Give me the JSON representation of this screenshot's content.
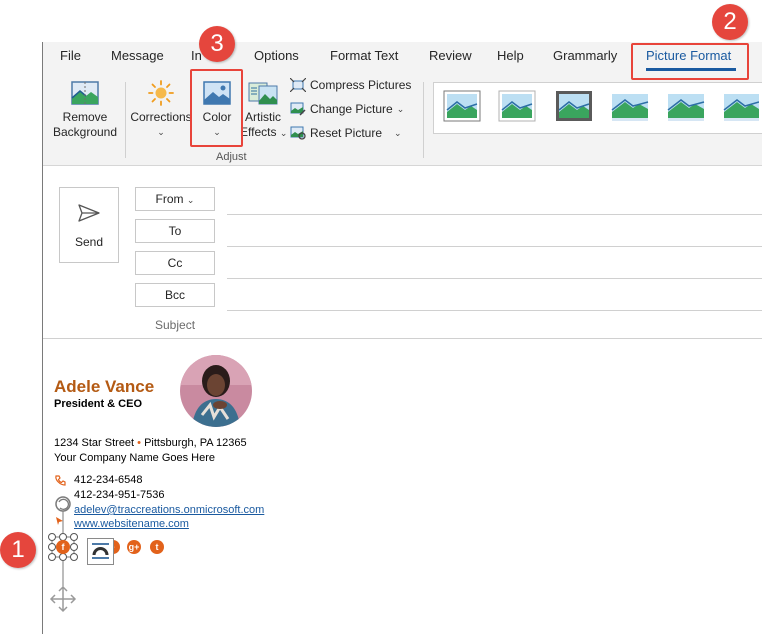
{
  "ribbon": {
    "tabs": [
      {
        "label": "File"
      },
      {
        "label": "Message"
      },
      {
        "label": "In"
      },
      {
        "label": "Options"
      },
      {
        "label": "Format Text"
      },
      {
        "label": "Review"
      },
      {
        "label": "Help"
      },
      {
        "label": "Grammarly"
      },
      {
        "label": "Picture Format"
      }
    ],
    "remove_background": {
      "line1": "Remove",
      "line2": "Background"
    },
    "corrections": {
      "label": "Corrections"
    },
    "color": {
      "label": "Color"
    },
    "artistic_effects": {
      "line1": "Artistic",
      "line2": "Effects"
    },
    "compress": "Compress Pictures",
    "change_picture": "Change Picture",
    "reset_picture": "Reset Picture",
    "adjust_group": "Adjust"
  },
  "callouts": {
    "one": "1",
    "two": "2",
    "three": "3"
  },
  "compose": {
    "send": "Send",
    "from": "From",
    "to": "To",
    "cc": "Cc",
    "bcc": "Bcc",
    "subject": "Subject"
  },
  "signature": {
    "name": "Adele Vance",
    "title": "President & CEO",
    "address_street": "1234 Star Street",
    "address_city": "Pittsburgh, PA 12365",
    "address_sep": "•",
    "company": "Your Company Name Goes Here",
    "phone1": "412-234-6548",
    "phone2": "412-234-951-7536",
    "email": "adelev@traccreations.onmicrosoft.com",
    "website": "www.websitename.com"
  },
  "colors": {
    "accent": "#1a5aa0",
    "callout": "#e5463d",
    "brand": "#b45a13",
    "social": "#e2621b"
  }
}
